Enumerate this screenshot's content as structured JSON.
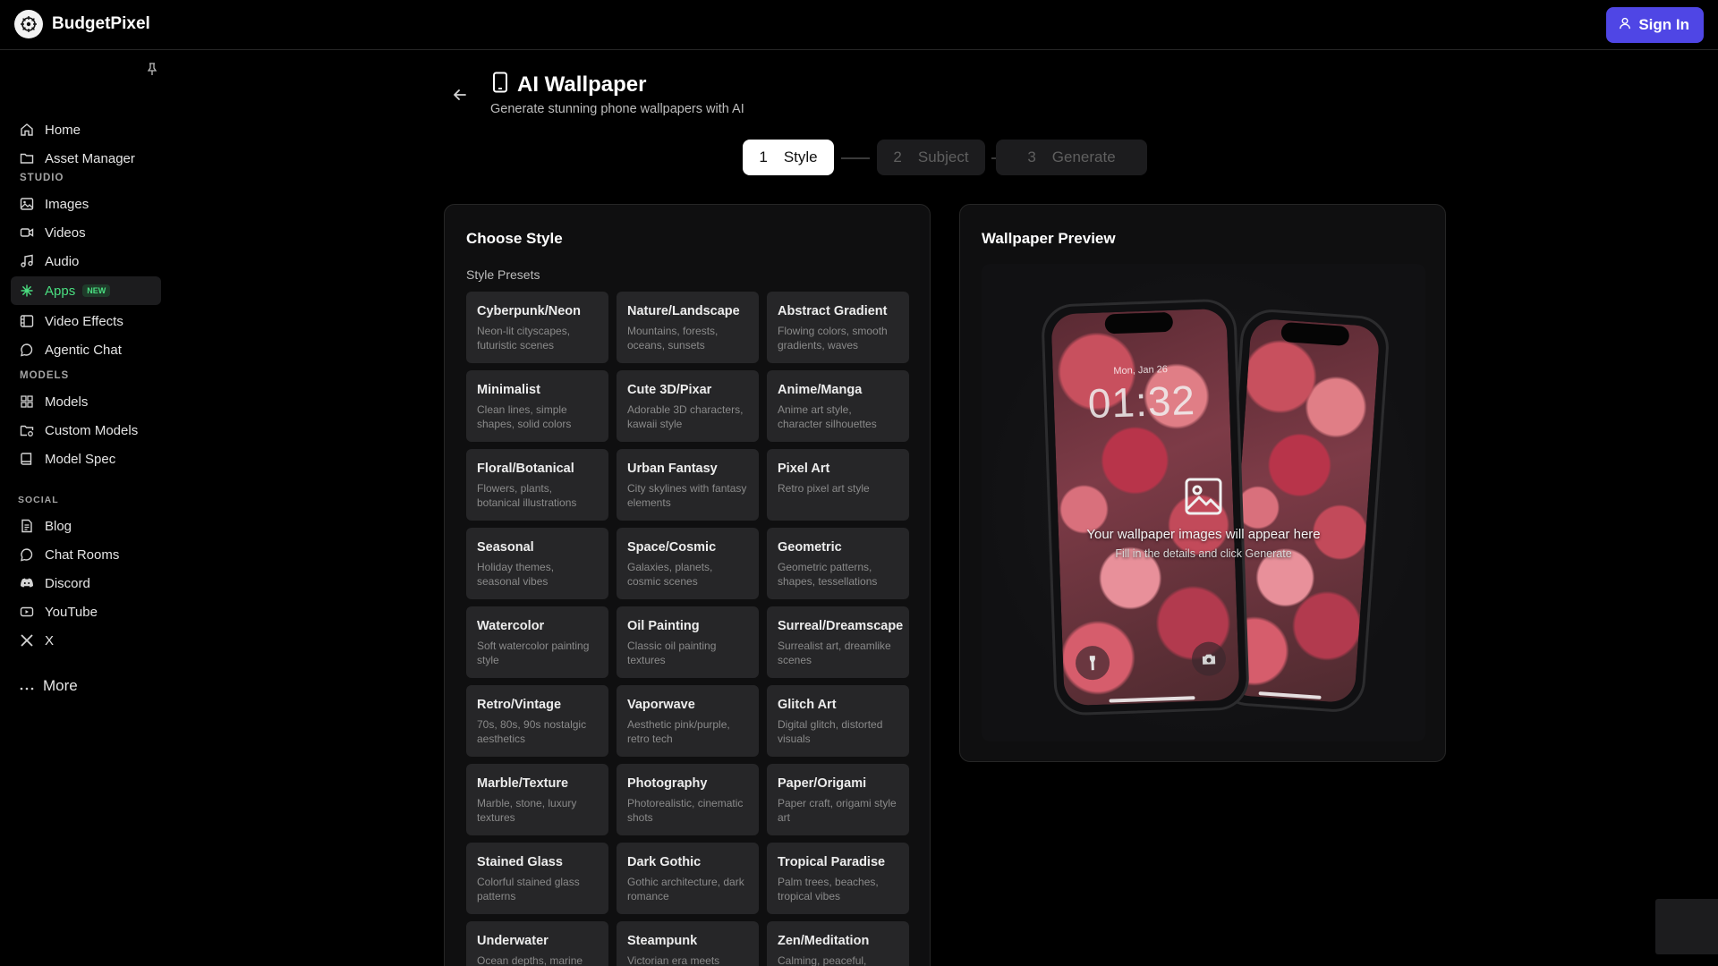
{
  "app": {
    "name": "BudgetPixel"
  },
  "header": {
    "sign_in_label": "Sign In"
  },
  "sidebar": {
    "top_items": [
      {
        "label": "Home",
        "icon": "home-icon"
      },
      {
        "label": "Asset Manager",
        "icon": "folder-icon"
      }
    ],
    "sections": [
      {
        "label": "STUDIO",
        "items": [
          {
            "label": "Images",
            "icon": "image-icon"
          },
          {
            "label": "Videos",
            "icon": "video-icon"
          },
          {
            "label": "Audio",
            "icon": "music-icon"
          },
          {
            "label": "Apps",
            "icon": "sparkle-icon",
            "badge": "NEW",
            "active": true
          },
          {
            "label": "Video Effects",
            "icon": "film-icon"
          },
          {
            "label": "Agentic Chat",
            "icon": "chat-icon"
          }
        ]
      },
      {
        "label": "MODELS",
        "items": [
          {
            "label": "Models",
            "icon": "grid-icon"
          },
          {
            "label": "Custom Models",
            "icon": "folder-cog-icon"
          },
          {
            "label": "Model Spec",
            "icon": "book-icon"
          }
        ]
      },
      {
        "label": "SOCIAL",
        "items": [
          {
            "label": "Blog",
            "icon": "document-icon"
          },
          {
            "label": "Chat Rooms",
            "icon": "chat-icon"
          },
          {
            "label": "Discord",
            "icon": "discord-icon"
          },
          {
            "label": "YouTube",
            "icon": "youtube-icon"
          },
          {
            "label": "X",
            "icon": "x-icon"
          }
        ]
      }
    ],
    "more_label": "More"
  },
  "page": {
    "title": "AI Wallpaper",
    "subtitle": "Generate stunning phone wallpapers with AI"
  },
  "stepper": [
    {
      "num": "1",
      "label": "Style",
      "active": true
    },
    {
      "num": "2",
      "label": "Subject",
      "active": false
    },
    {
      "num": "3",
      "label": "Generate",
      "active": false
    }
  ],
  "choose_style": {
    "title": "Choose Style",
    "presets_label": "Style Presets",
    "presets": [
      {
        "title": "Cyberpunk/Neon",
        "desc": "Neon-lit cityscapes, futuristic scenes"
      },
      {
        "title": "Nature/Landscape",
        "desc": "Mountains, forests, oceans, sunsets"
      },
      {
        "title": "Abstract Gradient",
        "desc": "Flowing colors, smooth gradients, waves"
      },
      {
        "title": "Minimalist",
        "desc": "Clean lines, simple shapes, solid colors"
      },
      {
        "title": "Cute 3D/Pixar",
        "desc": "Adorable 3D characters, kawaii style"
      },
      {
        "title": "Anime/Manga",
        "desc": "Anime art style, character silhouettes"
      },
      {
        "title": "Floral/Botanical",
        "desc": "Flowers, plants, botanical illustrations"
      },
      {
        "title": "Urban Fantasy",
        "desc": "City skylines with fantasy elements"
      },
      {
        "title": "Pixel Art",
        "desc": "Retro pixel art style"
      },
      {
        "title": "Seasonal",
        "desc": "Holiday themes, seasonal vibes"
      },
      {
        "title": "Space/Cosmic",
        "desc": "Galaxies, planets, cosmic scenes"
      },
      {
        "title": "Geometric",
        "desc": "Geometric patterns, shapes, tessellations"
      },
      {
        "title": "Watercolor",
        "desc": "Soft watercolor painting style"
      },
      {
        "title": "Oil Painting",
        "desc": "Classic oil painting textures"
      },
      {
        "title": "Surreal/Dreamscape",
        "desc": "Surrealist art, dreamlike scenes"
      },
      {
        "title": "Retro/Vintage",
        "desc": "70s, 80s, 90s nostalgic aesthetics"
      },
      {
        "title": "Vaporwave",
        "desc": "Aesthetic pink/purple, retro tech"
      },
      {
        "title": "Glitch Art",
        "desc": "Digital glitch, distorted visuals"
      },
      {
        "title": "Marble/Texture",
        "desc": "Marble, stone, luxury textures"
      },
      {
        "title": "Photography",
        "desc": "Photorealistic, cinematic shots"
      },
      {
        "title": "Paper/Origami",
        "desc": "Paper craft, origami style art"
      },
      {
        "title": "Stained Glass",
        "desc": "Colorful stained glass patterns"
      },
      {
        "title": "Dark Gothic",
        "desc": "Gothic architecture, dark romance"
      },
      {
        "title": "Tropical Paradise",
        "desc": "Palm trees, beaches, tropical vibes"
      },
      {
        "title": "Underwater",
        "desc": "Ocean depths, marine"
      },
      {
        "title": "Steampunk",
        "desc": "Victorian era meets"
      },
      {
        "title": "Zen/Meditation",
        "desc": "Calming, peaceful,"
      }
    ]
  },
  "preview": {
    "title": "Wallpaper Preview",
    "lock_date": "Mon, Jan 26",
    "lock_time": "01:32",
    "placeholder_main": "Your wallpaper images will appear here",
    "placeholder_sub": "Fill in the details and click Generate"
  },
  "colors": {
    "accent": "#4f46e5",
    "active_green": "#4ade80",
    "background": "#000000",
    "card": "#262628"
  }
}
